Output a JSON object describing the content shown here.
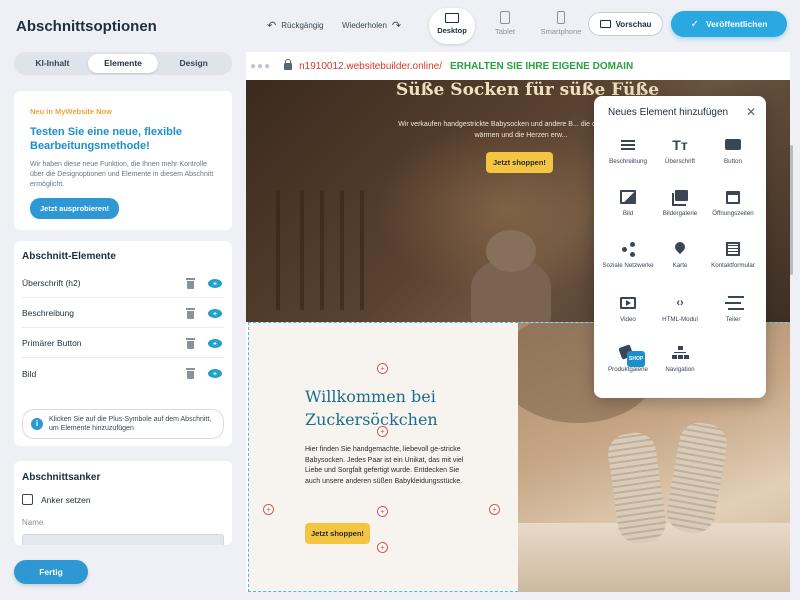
{
  "left_panel": {
    "title": "Abschnittsoptionen",
    "tabs": [
      "KI-Inhalt",
      "Elemente",
      "Design"
    ],
    "active_tab": "Elemente",
    "promo": {
      "kicker": "Neu in MyWebsite Now",
      "headline": "Testen Sie eine neue, flexible Bearbeitungsmethode!",
      "description": "Wir haben diese neue Funktion, die Ihnen mehr Kontrolle über die Designoptionen und Elemente in diesem Abschnitt ermöglicht.",
      "button": "Jetzt ausprobieren!"
    },
    "elements": {
      "title": "Abschnitt-Elemente",
      "items": [
        {
          "label": "Überschrift (h2)"
        },
        {
          "label": "Beschreibung"
        },
        {
          "label": "Primärer Button"
        },
        {
          "label": "Bild"
        }
      ],
      "hint": "Klicken Sie auf die Plus-Symbole auf dem Abschnitt, um Elemente hinzuzufügen"
    },
    "anchor": {
      "title": "Abschnittsanker",
      "checkbox_label": "Anker setzen",
      "name_label": "Name"
    },
    "done_button": "Fertig"
  },
  "toolbar": {
    "undo": "Rückgängig",
    "redo": "Wiederholen",
    "devices": [
      "Desktop",
      "Tablet",
      "Smartphone"
    ],
    "active_device": "Desktop",
    "preview": "Vorschau",
    "publish": "Veröffentlichen"
  },
  "canvas": {
    "url": "n1910012.websitebuilder.online/",
    "domain_cta": "ERHALTEN SIE IHRE EIGENE DOMAIN",
    "hero": {
      "title": "Süße Socken für süße Füße",
      "subtitle": "Wir verkaufen handgestrickte Babysocken und andere B... die die kleinen Füße wärmen und die Herzen erw...",
      "button": "Jetzt shoppen!"
    },
    "welcome": {
      "title": "Willkommen bei Zuckersöckchen",
      "text": "Hier finden Sie handgemachte, liebevoll ge-stricke Babysocken. Jedes Paar ist ein Unikat, das mit viel Liebe und Sorgfalt gefertigt wurde. Entdecken Sie auch unsere anderen süßen Babykleidungsstücke.",
      "button": "Jetzt shoppen!"
    }
  },
  "add_element_popup": {
    "title": "Neues Element hinzufügen",
    "items": [
      {
        "label": "Beschreibung",
        "icon": "lines-icon"
      },
      {
        "label": "Überschrift",
        "icon": "heading-icon"
      },
      {
        "label": "Button",
        "icon": "button-icon"
      },
      {
        "label": "Bild",
        "icon": "image-icon"
      },
      {
        "label": "Bildergalerie",
        "icon": "gallery-icon"
      },
      {
        "label": "Öffnungszeiten",
        "icon": "calendar-icon"
      },
      {
        "label": "Soziale Netzwerke",
        "icon": "share-icon"
      },
      {
        "label": "Karte",
        "icon": "map-pin-icon"
      },
      {
        "label": "Kontaktformular",
        "icon": "form-icon"
      },
      {
        "label": "Video",
        "icon": "video-icon"
      },
      {
        "label": "HTML-Modul",
        "icon": "code-icon"
      },
      {
        "label": "Teiler",
        "icon": "divider-icon"
      },
      {
        "label": "Produktgalerie",
        "icon": "shop-icon"
      },
      {
        "label": "Navigation",
        "icon": "navigation-icon"
      }
    ],
    "shop_badge": "SHOP"
  }
}
